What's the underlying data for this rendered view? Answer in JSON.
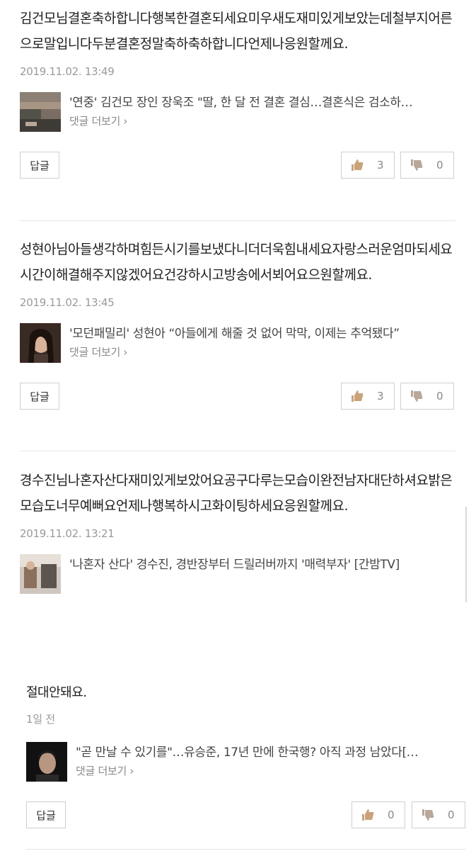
{
  "comments": [
    {
      "text": "김건모님결혼축하합니다행복한결혼되세요미우새도재미있게보았는데철부지어른으로말입니다두분결혼정말축하축하합니다언제나응원할께요.",
      "date": "2019.11.02. 13:49",
      "news_title": "'연중' 김건모 장인 장욱조 \"딸, 한 달 전 결혼 결심…결혼식은 검소하…",
      "more": "댓글 더보기 ›",
      "reply": "답글",
      "likes": "3",
      "dislikes": "0"
    },
    {
      "text": "성현아님아들생각하며힘든시기를보냈다니더더욱힘내세요자랑스러운엄마되세요시간이해결해주지않겠어요건강하시고방송에서뵈어요으원할께요.",
      "date": "2019.11.02. 13:45",
      "news_title": "'모던패밀리' 성현아 “아들에게 해줄 것 없어 막막, 이제는 추억됐다”",
      "more": "댓글 더보기 ›",
      "reply": "답글",
      "likes": "3",
      "dislikes": "0"
    },
    {
      "text": "경수진님나혼자산다재미있게보았어요공구다루는모습이완전남자대단하셔요밝은모습도너무예뻐요언제나행복하시고화이팅하세요응원할께요.",
      "date": "2019.11.02. 13:21",
      "news_title": "'나혼자 산다' 경수진, 경반장부터 드릴러버까지 '매력부자' [간밤TV]"
    },
    {
      "text": "절대안돼요.",
      "date": "1일 전",
      "news_title": "\"곧 만날 수 있기를\"…유승준, 17년 만에 한국행? 아직 과정 남았다[…",
      "more": "댓글 더보기 ›",
      "reply": "답글",
      "likes": "0",
      "dislikes": "0"
    }
  ],
  "icons": {
    "like": "thumbs-up-icon",
    "dislike": "thumbs-down-icon"
  },
  "colors": {
    "text": "#1e1e1e",
    "meta": "#9a9a9a",
    "border": "#cfcfcf",
    "thumb_icon": "#c9a27a"
  }
}
